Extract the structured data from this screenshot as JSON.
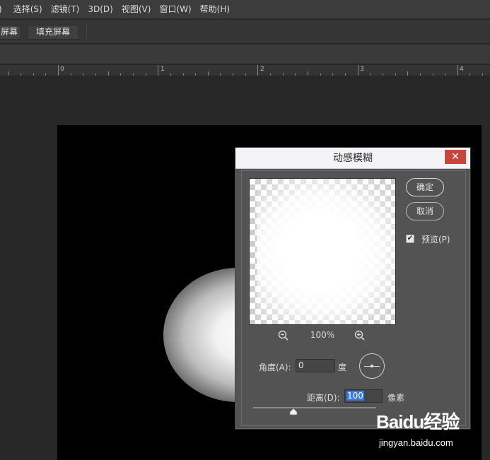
{
  "menubar": {
    "items": [
      {
        "label": ")"
      },
      {
        "label": "选择(S)"
      },
      {
        "label": "滤镜(T)"
      },
      {
        "label": "3D(D)"
      },
      {
        "label": "视图(V)"
      },
      {
        "label": "窗口(W)"
      },
      {
        "label": "帮助(H)"
      }
    ]
  },
  "options": {
    "screen_label": "屏幕",
    "fill_screen_label": "填充屏幕"
  },
  "ruler": {
    "labels": [
      "0",
      "1",
      "2",
      "3",
      "4"
    ]
  },
  "dialog": {
    "title": "动感模糊",
    "close_glyph": "✕",
    "ok_label": "确定",
    "cancel_label": "取消",
    "preview_label": "预览(P)",
    "preview_checked": true,
    "check_glyph": "✔",
    "zoom_level": "100%",
    "angle_label": "角度(A):",
    "angle_value": "0",
    "angle_unit": "度",
    "distance_label": "距离(D):",
    "distance_value": "100",
    "distance_unit": "像素",
    "slider_level": 0.33
  },
  "watermark": {
    "brand": "Baidu经验",
    "url": "jingyan.baidu.com"
  },
  "icons": {
    "zoom_out": "zoom-out-icon",
    "zoom_in": "zoom-in-icon",
    "angle": "angle-dial-icon",
    "slider": "slider-thumb-icon"
  },
  "colors": {
    "menubar": "#3c3c3c",
    "workspace": "#282828",
    "dialog": "#535353",
    "close_button": "#c9463f",
    "selection": "#3b7bd8"
  }
}
